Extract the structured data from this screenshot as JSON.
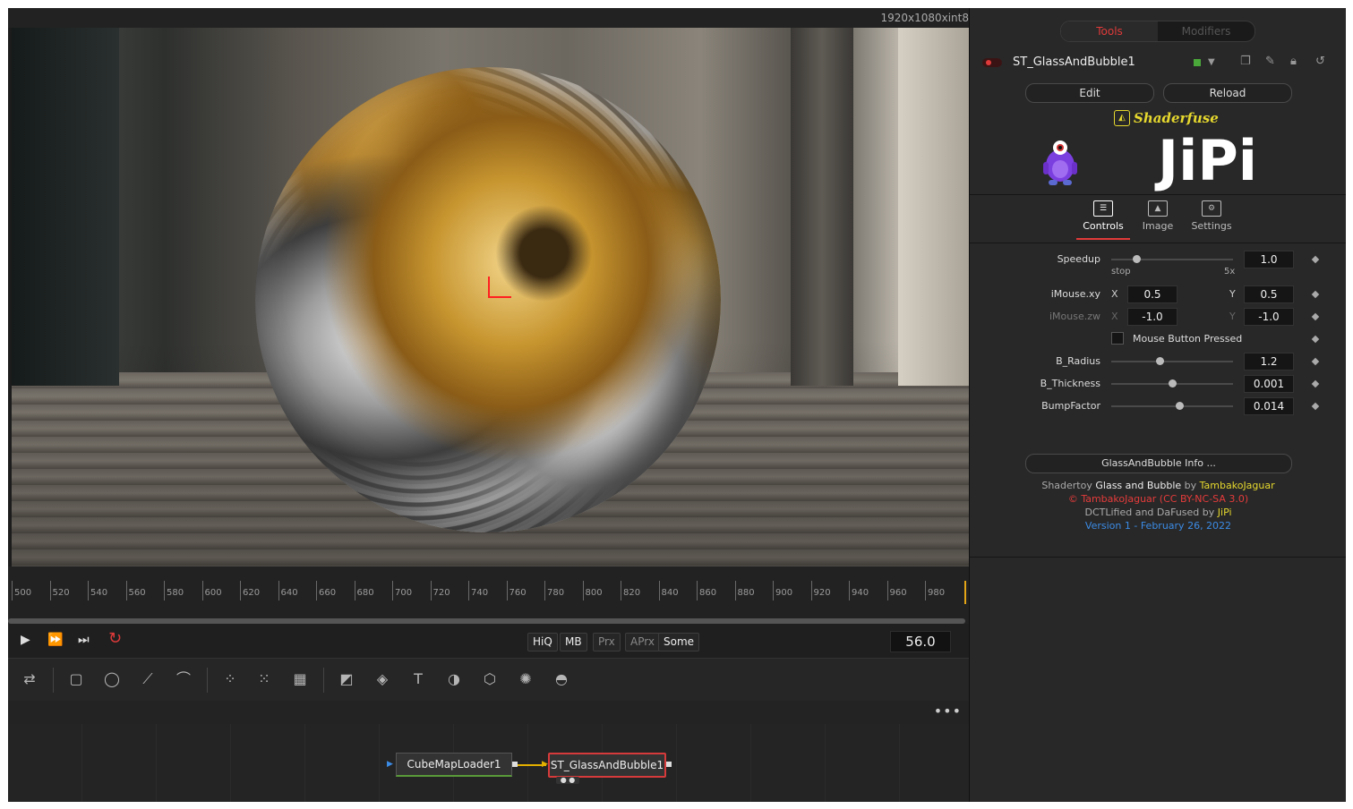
{
  "viewer": {
    "resolution": "1920x1080xint8"
  },
  "timeline": {
    "ticks": [
      "500",
      "520",
      "540",
      "560",
      "580",
      "600",
      "620",
      "640",
      "660",
      "680",
      "700",
      "720",
      "740",
      "760",
      "780",
      "800",
      "820",
      "840",
      "860",
      "880",
      "900",
      "920",
      "940",
      "960",
      "980"
    ]
  },
  "transport": {
    "quality": [
      "HiQ",
      "MB",
      "Prx",
      "APrx",
      "Some"
    ],
    "frame": "56.0"
  },
  "nodes": {
    "loader": "CubeMapLoader1",
    "shader": "ST_GlassAndBubble1"
  },
  "inspector": {
    "tabs": {
      "tools": "Tools",
      "modifiers": "Modifiers"
    },
    "node_name": "ST_GlassAndBubble1",
    "edit": "Edit",
    "reload": "Reload",
    "brand": "Shaderfuse",
    "author_logo": "JiPi",
    "ctrl_tabs": {
      "controls": "Controls",
      "image": "Image",
      "settings": "Settings"
    },
    "params": {
      "speedup": {
        "label": "Speedup",
        "value": "1.0",
        "min": "stop",
        "max": "5x"
      },
      "imousexy": {
        "label": "iMouse.xy",
        "x": "0.5",
        "y": "0.5",
        "xl": "X",
        "yl": "Y"
      },
      "imousezw": {
        "label": "iMouse.zw",
        "x": "-1.0",
        "y": "-1.0",
        "xl": "X",
        "yl": "Y"
      },
      "mousebtn": {
        "label": "Mouse Button Pressed"
      },
      "bradius": {
        "label": "B_Radius",
        "value": "1.2"
      },
      "bthick": {
        "label": "B_Thickness",
        "value": "0.001"
      },
      "bump": {
        "label": "BumpFactor",
        "value": "0.014"
      }
    },
    "info_button": "GlassAndBubble Info ...",
    "credits": {
      "l1a": "Shadertoy",
      "l1b": "Glass and Bubble",
      "l1c": "by",
      "l1d": "TambakoJaguar",
      "l2": "© TambakoJaguar (CC BY-NC-SA 3.0)",
      "l3a": "DCTLified and DaFused by",
      "l3b": "JiPi",
      "l4": "Version 1 - February 26, 2022"
    }
  }
}
